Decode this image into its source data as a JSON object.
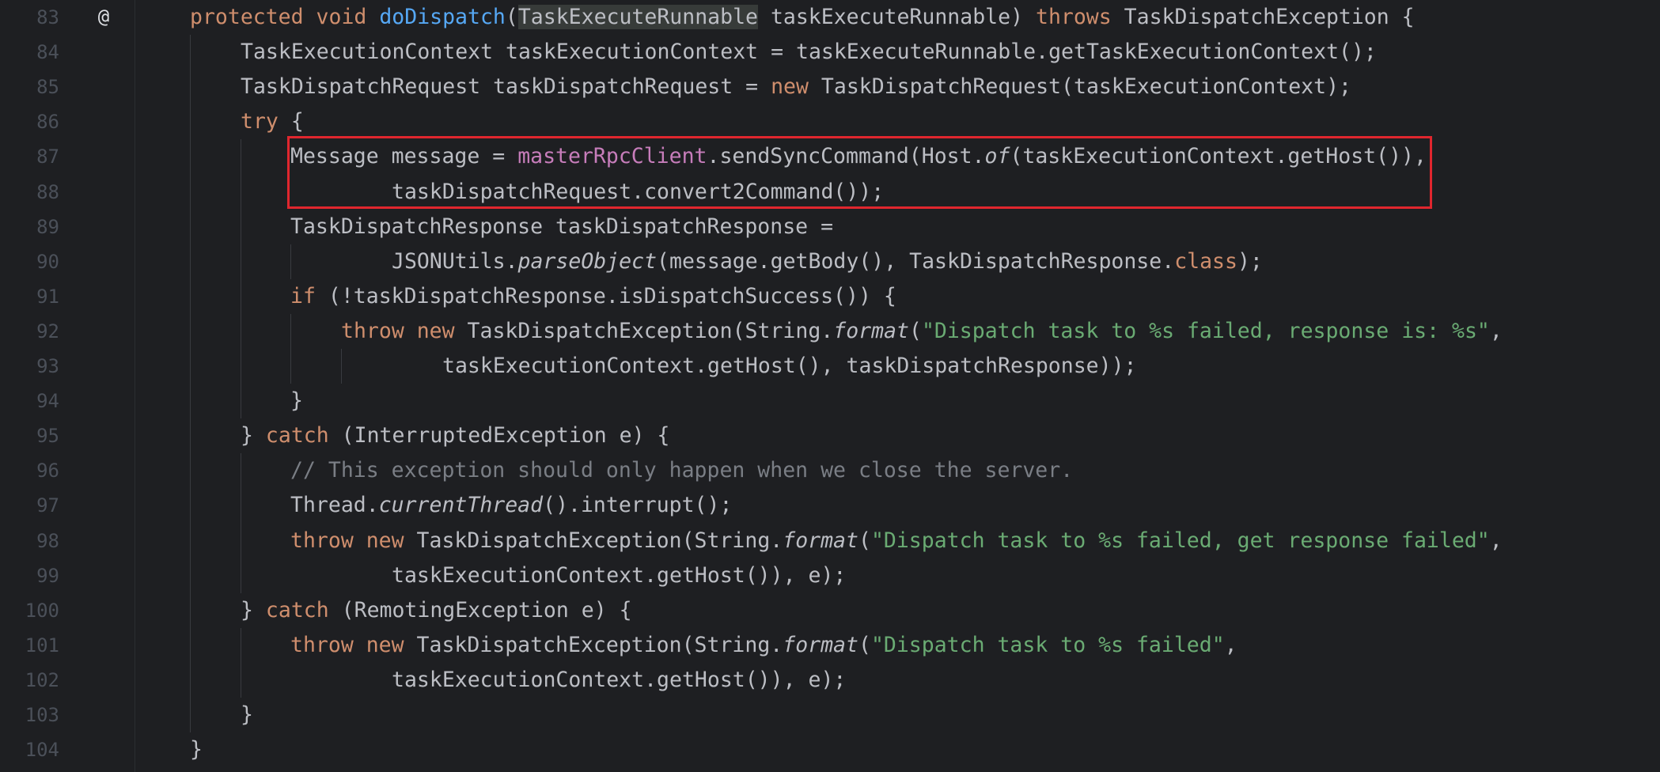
{
  "editor": {
    "colors": {
      "background": "#1e1f22",
      "keyword": "#cf8e6d",
      "method": "#56a8f5",
      "field": "#c77dbb",
      "string": "#6aab73",
      "comment": "#7a7e85",
      "highlight_box": "#e0262e"
    },
    "gutter_icon": "@",
    "lines": [
      {
        "num": "83",
        "tokens": [
          {
            "t": "protected void ",
            "c": "kw"
          },
          {
            "t": "doDispatch",
            "c": "fn"
          },
          {
            "t": "(",
            "c": ""
          },
          {
            "t": "TaskExecuteRunnable",
            "c": "usage-hl"
          },
          {
            "t": " taskExecuteRunnable) ",
            "c": ""
          },
          {
            "t": "throws ",
            "c": "kw"
          },
          {
            "t": "TaskDispatchException {",
            "c": ""
          }
        ]
      },
      {
        "num": "84",
        "tokens": [
          {
            "t": "TaskExecutionContext taskExecutionContext = taskExecuteRunnable.getTaskExecutionContext();",
            "c": ""
          }
        ]
      },
      {
        "num": "85",
        "tokens": [
          {
            "t": "TaskDispatchRequest taskDispatchRequest = ",
            "c": ""
          },
          {
            "t": "new ",
            "c": "kw"
          },
          {
            "t": "TaskDispatchRequest(taskExecutionContext);",
            "c": ""
          }
        ]
      },
      {
        "num": "86",
        "tokens": [
          {
            "t": "try ",
            "c": "kw"
          },
          {
            "t": "{",
            "c": ""
          }
        ]
      },
      {
        "num": "87",
        "tokens": [
          {
            "t": "Message message = ",
            "c": ""
          },
          {
            "t": "masterRpcClient",
            "c": "field"
          },
          {
            "t": ".sendSyncCommand(Host.",
            "c": ""
          },
          {
            "t": "of",
            "c": "it"
          },
          {
            "t": "(taskExecutionContext.getHost()),",
            "c": ""
          }
        ]
      },
      {
        "num": "88",
        "tokens": [
          {
            "t": "taskDispatchRequest.convert2Command());",
            "c": ""
          }
        ]
      },
      {
        "num": "89",
        "tokens": [
          {
            "t": "TaskDispatchResponse taskDispatchResponse =",
            "c": ""
          }
        ]
      },
      {
        "num": "90",
        "tokens": [
          {
            "t": "JSONUtils.",
            "c": ""
          },
          {
            "t": "parseObject",
            "c": "it"
          },
          {
            "t": "(message.getBody(), TaskDispatchResponse.",
            "c": ""
          },
          {
            "t": "class",
            "c": "kw"
          },
          {
            "t": ");",
            "c": ""
          }
        ]
      },
      {
        "num": "91",
        "tokens": [
          {
            "t": "if ",
            "c": "kw"
          },
          {
            "t": "(!taskDispatchResponse.isDispatchSuccess()) {",
            "c": ""
          }
        ]
      },
      {
        "num": "92",
        "tokens": [
          {
            "t": "throw new ",
            "c": "kw"
          },
          {
            "t": "TaskDispatchException(String.",
            "c": ""
          },
          {
            "t": "format",
            "c": "it"
          },
          {
            "t": "(",
            "c": ""
          },
          {
            "t": "\"Dispatch task to %s failed, response is: %s\"",
            "c": "str"
          },
          {
            "t": ",",
            "c": ""
          }
        ]
      },
      {
        "num": "93",
        "tokens": [
          {
            "t": "taskExecutionContext.getHost(), taskDispatchResponse));",
            "c": ""
          }
        ]
      },
      {
        "num": "94",
        "tokens": [
          {
            "t": "}",
            "c": ""
          }
        ]
      },
      {
        "num": "95",
        "tokens": [
          {
            "t": "} ",
            "c": ""
          },
          {
            "t": "catch ",
            "c": "kw"
          },
          {
            "t": "(InterruptedException e) {",
            "c": ""
          }
        ]
      },
      {
        "num": "96",
        "tokens": [
          {
            "t": "// This exception should only happen when we close the server.",
            "c": "cmt"
          }
        ]
      },
      {
        "num": "97",
        "tokens": [
          {
            "t": "Thread.",
            "c": ""
          },
          {
            "t": "currentThread",
            "c": "it"
          },
          {
            "t": "().interrupt();",
            "c": ""
          }
        ]
      },
      {
        "num": "98",
        "tokens": [
          {
            "t": "throw new ",
            "c": "kw"
          },
          {
            "t": "TaskDispatchException(String.",
            "c": ""
          },
          {
            "t": "format",
            "c": "it"
          },
          {
            "t": "(",
            "c": ""
          },
          {
            "t": "\"Dispatch task to %s failed, get response failed\"",
            "c": "str"
          },
          {
            "t": ",",
            "c": ""
          }
        ]
      },
      {
        "num": "99",
        "tokens": [
          {
            "t": "taskExecutionContext.getHost()), e);",
            "c": ""
          }
        ]
      },
      {
        "num": "100",
        "tokens": [
          {
            "t": "} ",
            "c": ""
          },
          {
            "t": "catch ",
            "c": "kw"
          },
          {
            "t": "(RemotingException e) {",
            "c": ""
          }
        ]
      },
      {
        "num": "101",
        "tokens": [
          {
            "t": "throw new ",
            "c": "kw"
          },
          {
            "t": "TaskDispatchException(String.",
            "c": ""
          },
          {
            "t": "format",
            "c": "it"
          },
          {
            "t": "(",
            "c": ""
          },
          {
            "t": "\"Dispatch task to %s failed\"",
            "c": "str"
          },
          {
            "t": ",",
            "c": ""
          }
        ]
      },
      {
        "num": "102",
        "tokens": [
          {
            "t": "taskExecutionContext.getHost()), e);",
            "c": ""
          }
        ]
      },
      {
        "num": "103",
        "tokens": [
          {
            "t": "}",
            "c": ""
          }
        ]
      },
      {
        "num": "104",
        "tokens": [
          {
            "t": "}",
            "c": ""
          }
        ]
      }
    ]
  }
}
